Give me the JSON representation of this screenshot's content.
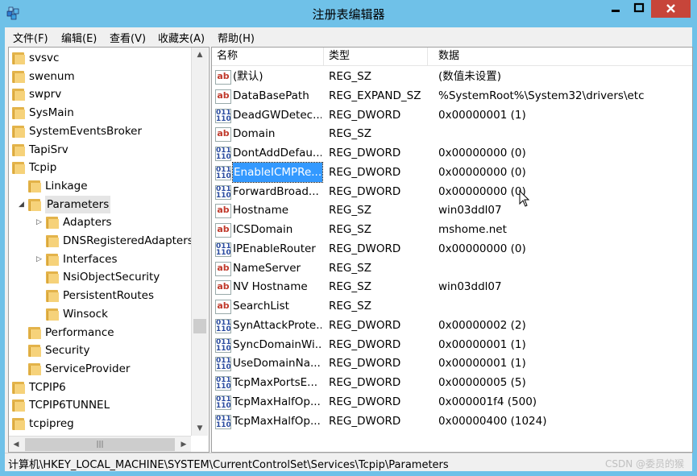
{
  "window": {
    "title": "注册表编辑器"
  },
  "menu": [
    "文件(F)",
    "编辑(E)",
    "查看(V)",
    "收藏夹(A)",
    "帮助(H)"
  ],
  "tree": [
    {
      "label": "svsvc",
      "level": 0
    },
    {
      "label": "swenum",
      "level": 0
    },
    {
      "label": "swprv",
      "level": 0
    },
    {
      "label": "SysMain",
      "level": 0
    },
    {
      "label": "SystemEventsBroker",
      "level": 0
    },
    {
      "label": "TapiSrv",
      "level": 0
    },
    {
      "label": "Tcpip",
      "level": 0
    },
    {
      "label": "Linkage",
      "level": 1
    },
    {
      "label": "Parameters",
      "level": 1,
      "expanded": true,
      "selected": true
    },
    {
      "label": "Adapters",
      "level": 2,
      "expander": true
    },
    {
      "label": "DNSRegisteredAdapters",
      "level": 2
    },
    {
      "label": "Interfaces",
      "level": 2,
      "expander": true
    },
    {
      "label": "NsiObjectSecurity",
      "level": 2
    },
    {
      "label": "PersistentRoutes",
      "level": 2
    },
    {
      "label": "Winsock",
      "level": 2
    },
    {
      "label": "Performance",
      "level": 1
    },
    {
      "label": "Security",
      "level": 1
    },
    {
      "label": "ServiceProvider",
      "level": 1
    },
    {
      "label": "TCPIP6",
      "level": 0
    },
    {
      "label": "TCPIP6TUNNEL",
      "level": 0
    },
    {
      "label": "tcpipreg",
      "level": 0
    }
  ],
  "columns": {
    "name": "名称",
    "type": "类型",
    "data": "数据"
  },
  "values": [
    {
      "name": "(默认)",
      "type": "REG_SZ",
      "data": "(数值未设置)",
      "kind": "sz"
    },
    {
      "name": "DataBasePath",
      "type": "REG_EXPAND_SZ",
      "data": "%SystemRoot%\\System32\\drivers\\etc",
      "kind": "sz"
    },
    {
      "name": "DeadGWDetec...",
      "type": "REG_DWORD",
      "data": "0x00000001 (1)",
      "kind": "dw"
    },
    {
      "name": "Domain",
      "type": "REG_SZ",
      "data": "",
      "kind": "sz"
    },
    {
      "name": "DontAddDefau...",
      "type": "REG_DWORD",
      "data": "0x00000000 (0)",
      "kind": "dw"
    },
    {
      "name": "EnableICMPRe...",
      "type": "REG_DWORD",
      "data": "0x00000000 (0)",
      "kind": "dw",
      "selected": true
    },
    {
      "name": "ForwardBroad...",
      "type": "REG_DWORD",
      "data": "0x00000000 (0)",
      "kind": "dw"
    },
    {
      "name": "Hostname",
      "type": "REG_SZ",
      "data": "win03ddl07",
      "kind": "sz"
    },
    {
      "name": "ICSDomain",
      "type": "REG_SZ",
      "data": "mshome.net",
      "kind": "sz"
    },
    {
      "name": "IPEnableRouter",
      "type": "REG_DWORD",
      "data": "0x00000000 (0)",
      "kind": "dw"
    },
    {
      "name": "NameServer",
      "type": "REG_SZ",
      "data": "",
      "kind": "sz"
    },
    {
      "name": "NV Hostname",
      "type": "REG_SZ",
      "data": "win03ddl07",
      "kind": "sz"
    },
    {
      "name": "SearchList",
      "type": "REG_SZ",
      "data": "",
      "kind": "sz"
    },
    {
      "name": "SynAttackProte...",
      "type": "REG_DWORD",
      "data": "0x00000002 (2)",
      "kind": "dw"
    },
    {
      "name": "SyncDomainWi...",
      "type": "REG_DWORD",
      "data": "0x00000001 (1)",
      "kind": "dw"
    },
    {
      "name": "UseDomainNa...",
      "type": "REG_DWORD",
      "data": "0x00000001 (1)",
      "kind": "dw"
    },
    {
      "name": "TcpMaxPortsE...",
      "type": "REG_DWORD",
      "data": "0x00000005 (5)",
      "kind": "dw"
    },
    {
      "name": "TcpMaxHalfOp...",
      "type": "REG_DWORD",
      "data": "0x000001f4 (500)",
      "kind": "dw"
    },
    {
      "name": "TcpMaxHalfOp...",
      "type": "REG_DWORD",
      "data": "0x00000400 (1024)",
      "kind": "dw"
    }
  ],
  "icons": {
    "sz": "ab",
    "dw": "011\n110"
  },
  "status": {
    "path": "计算机\\HKEY_LOCAL_MACHINE\\SYSTEM\\CurrentControlSet\\Services\\Tcpip\\Parameters",
    "watermark": "CSDN @委员的猴"
  },
  "colors": {
    "titlebar": "#6fc1e8",
    "close": "#c7453a",
    "selection": "#3399ff",
    "folder": "#f6d27a"
  }
}
